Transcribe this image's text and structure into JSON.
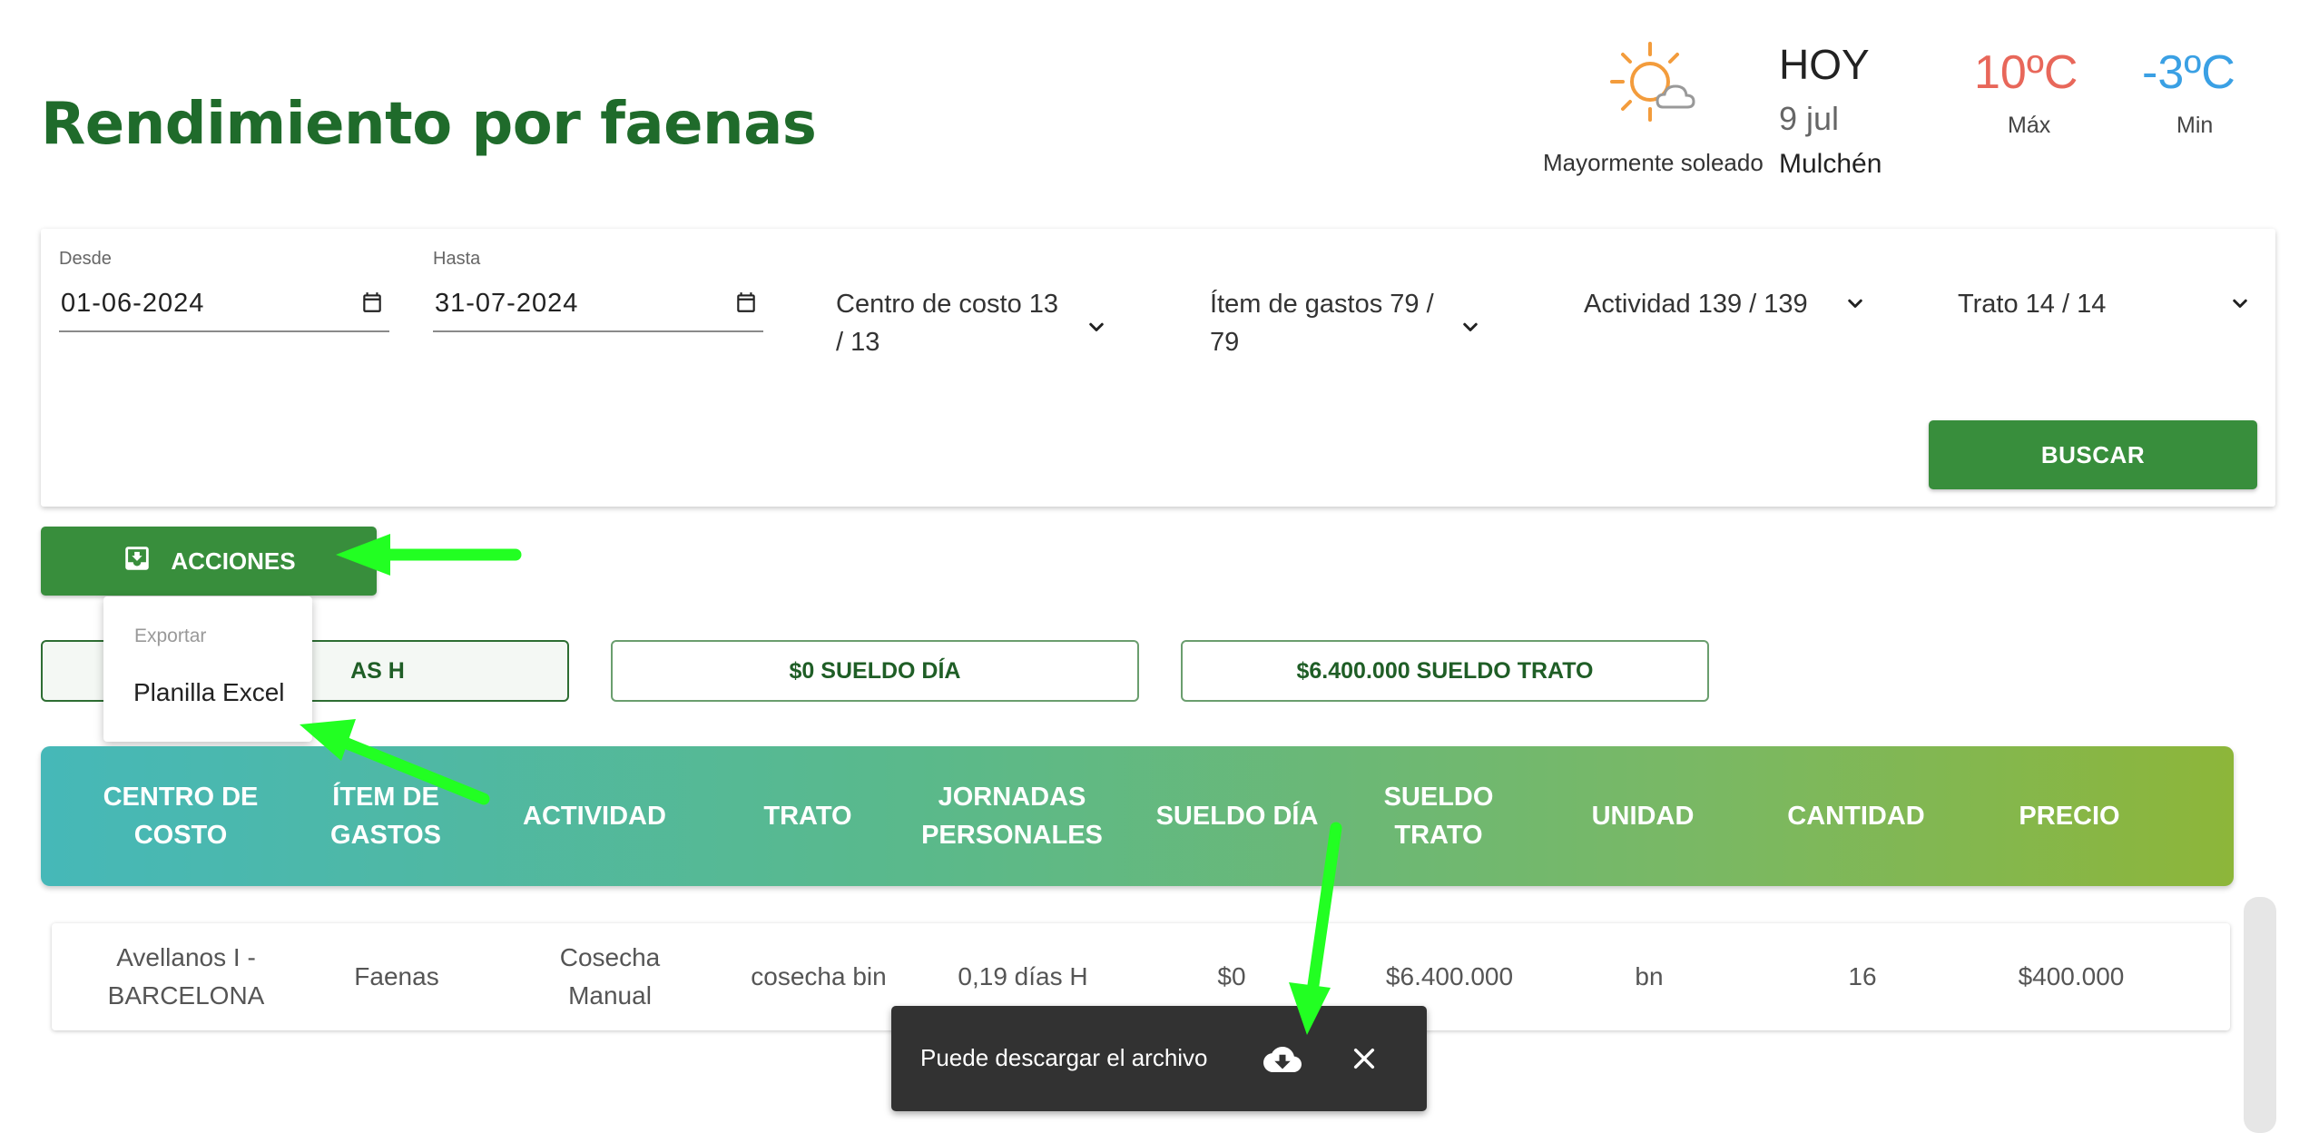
{
  "header": {
    "title": "Rendimiento por faenas"
  },
  "weather": {
    "description": "Mayormente soleado",
    "today": "HOY",
    "date": "9 jul",
    "location": "Mulchén",
    "max": "10ºC",
    "max_label": "Máx",
    "min": "-3ºC",
    "min_label": "Min",
    "icon": "partly-sunny-icon",
    "max_color": "#e8675a",
    "min_color": "#3aa0e4"
  },
  "filters": {
    "desde_label": "Desde",
    "desde_value": "01-06-2024",
    "hasta_label": "Hasta",
    "hasta_value": "31-07-2024",
    "centro_costo": "Centro de costo 13 / 13",
    "item_gastos": "Ítem de gastos 79 / 79",
    "actividad": "Actividad 139 / 139",
    "trato": "Trato 14 / 14",
    "buscar": "BUSCAR"
  },
  "actions": {
    "label": "ACCIONES",
    "icon": "inbox-icon",
    "menu_header": "Exportar",
    "menu_item": "Planilla Excel"
  },
  "summary": {
    "chip1": "AS H",
    "chip2": "$0 SUELDO DÍA",
    "chip3": "$6.400.000 SUELDO TRATO"
  },
  "table": {
    "headers": [
      "CENTRO DE COSTO",
      "ÍTEM DE GASTOS",
      "ACTIVIDAD",
      "TRATO",
      "JORNADAS PERSONALES",
      "SUELDO DÍA",
      "SUELDO TRATO",
      "UNIDAD",
      "CANTIDAD",
      "PRECIO"
    ],
    "rows": [
      [
        "Avellanos I - BARCELONA",
        "Faenas",
        "Cosecha Manual",
        "cosecha bin",
        "0,19 días H",
        "$0",
        "$6.400.000",
        "bn",
        "16",
        "$400.000"
      ]
    ]
  },
  "snackbar": {
    "message": "Puede descargar el archivo",
    "download_icon": "cloud-download-icon",
    "close_icon": "close-icon"
  },
  "colors": {
    "brand_green": "#388e3c",
    "title_green": "#1f6b2b",
    "annotation_arrow": "#22ff22"
  }
}
